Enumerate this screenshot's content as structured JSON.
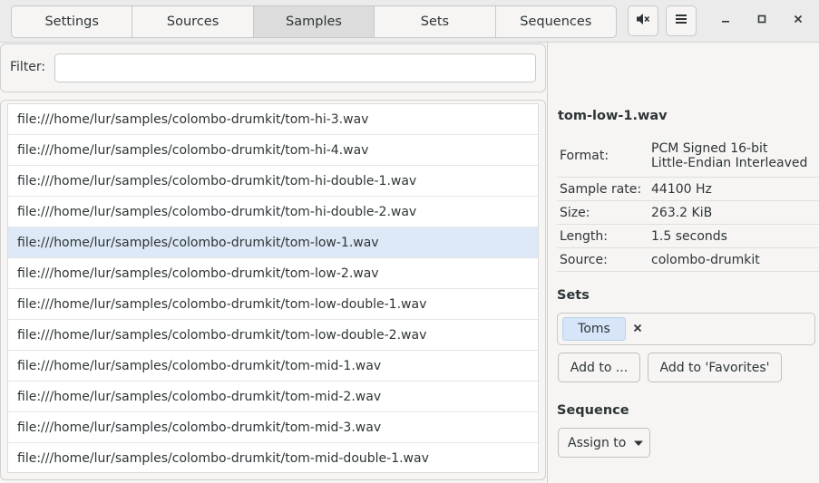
{
  "tabs": [
    {
      "label": "Settings"
    },
    {
      "label": "Sources"
    },
    {
      "label": "Samples",
      "active": true
    },
    {
      "label": "Sets"
    },
    {
      "label": "Sequences"
    }
  ],
  "header": {
    "mute_icon": "volume-muted-icon",
    "menu_icon": "hamburger-menu-icon",
    "window_controls": [
      "minimize-icon",
      "maximize-icon",
      "close-icon"
    ]
  },
  "filter": {
    "label": "Filter:",
    "value": "",
    "placeholder": ""
  },
  "samples": [
    "file:///home/lur/samples/colombo-drumkit/tom-hi-3.wav",
    "file:///home/lur/samples/colombo-drumkit/tom-hi-4.wav",
    "file:///home/lur/samples/colombo-drumkit/tom-hi-double-1.wav",
    "file:///home/lur/samples/colombo-drumkit/tom-hi-double-2.wav",
    "file:///home/lur/samples/colombo-drumkit/tom-low-1.wav",
    "file:///home/lur/samples/colombo-drumkit/tom-low-2.wav",
    "file:///home/lur/samples/colombo-drumkit/tom-low-double-1.wav",
    "file:///home/lur/samples/colombo-drumkit/tom-low-double-2.wav",
    "file:///home/lur/samples/colombo-drumkit/tom-mid-1.wav",
    "file:///home/lur/samples/colombo-drumkit/tom-mid-2.wav",
    "file:///home/lur/samples/colombo-drumkit/tom-mid-3.wav",
    "file:///home/lur/samples/colombo-drumkit/tom-mid-double-1.wav"
  ],
  "selected_index": 4,
  "details": {
    "title": "tom-low-1.wav",
    "rows": [
      {
        "key": "Format:",
        "value": "PCM Signed 16-bit\nLittle-Endian Interleaved"
      },
      {
        "key": "Sample rate:",
        "value": "44100 Hz"
      },
      {
        "key": "Size:",
        "value": "263.2 KiB"
      },
      {
        "key": "Length:",
        "value": "1.5 seconds"
      },
      {
        "key": "Source:",
        "value": "colombo-drumkit"
      }
    ]
  },
  "sets": {
    "label": "Sets",
    "tags": [
      "Toms"
    ],
    "add_to_label": "Add to ...",
    "add_favorites_label": "Add to 'Favorites'"
  },
  "sequence": {
    "label": "Sequence",
    "assign_label": "Assign to"
  },
  "colors": {
    "selected_row": "#dde9f7",
    "chip": "#d6e6f8",
    "window_bg": "#f6f5f4",
    "header_bg": "#ebebeb"
  }
}
